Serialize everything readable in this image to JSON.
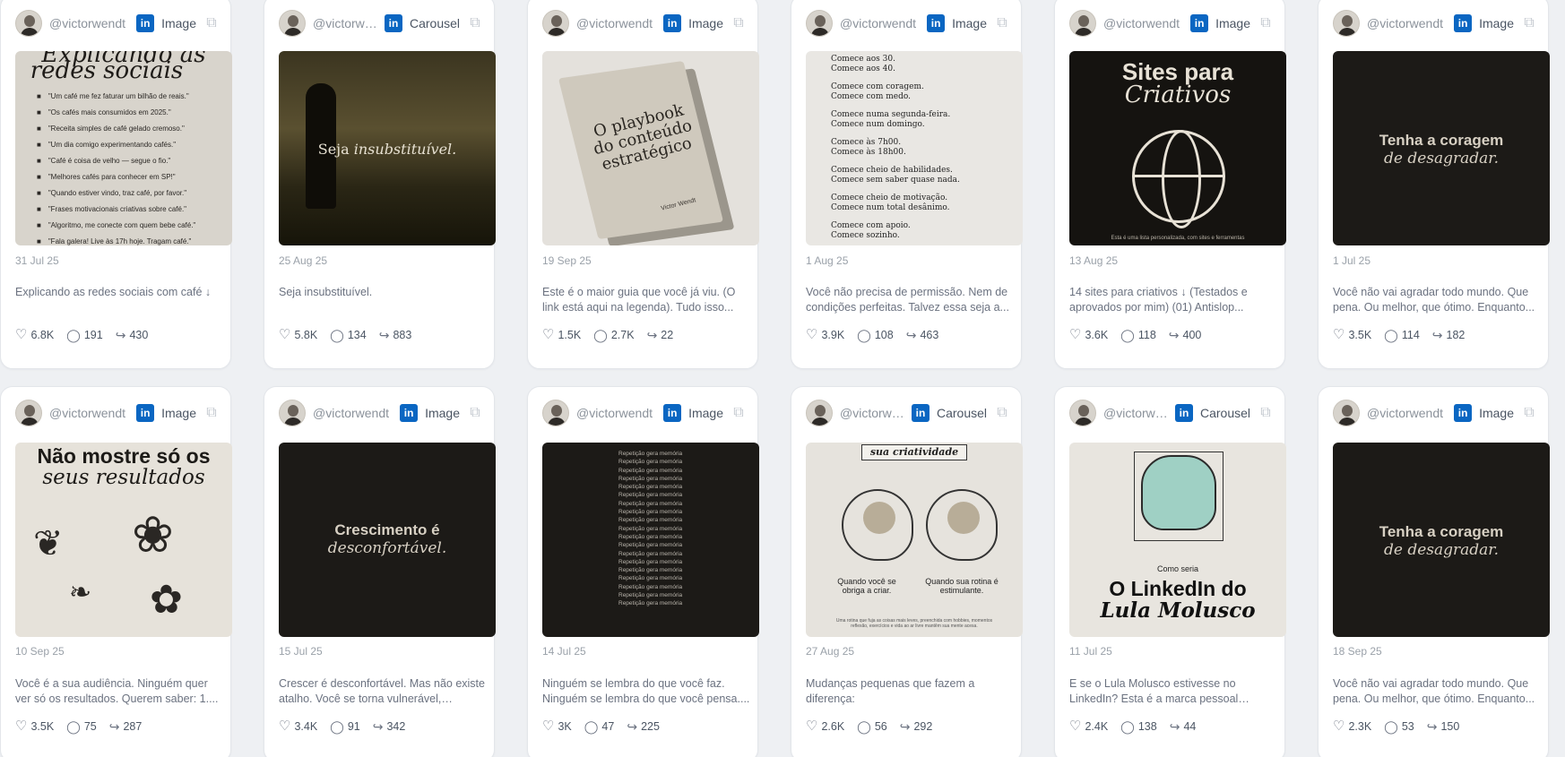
{
  "colors": {
    "background": "#eef0f3",
    "linkedin": "#0a66c2",
    "card": "#ffffff"
  },
  "cards": [
    {
      "handle": "@victorwendt",
      "type": "Image",
      "date": "31 Jul 25",
      "caption": "Explicando as redes sociais com café ↓",
      "likes": "6.8K",
      "comments": "191",
      "shares": "430",
      "media": {
        "title_line1": "Explicando as",
        "title_line2": "redes sociais",
        "lines": [
          "\"Um café me fez faturar um bilhão de reais.\"",
          "\"Os cafés mais consumidos em 2025.\"",
          "\"Receita simples de café gelado cremoso.\"",
          "\"Um dia comigo experimentando cafés.\"",
          "\"Café é coisa de velho — segue o fio.\"",
          "\"Melhores cafés para conhecer em SP!\"",
          "\"Quando estiver vindo, traz café, por favor.\"",
          "\"Frases motivacionais criativas sobre café.\"",
          "\"Algoritmo, me conecte com quem bebe café.\"",
          "\"Fala galera! Live às 17h hoje. Tragam café.\""
        ]
      }
    },
    {
      "handle": "@victorwen...",
      "type": "Carousel",
      "date": "25 Aug 25",
      "caption": "Seja insubstituível.",
      "likes": "5.8K",
      "comments": "134",
      "shares": "883",
      "media": {
        "text_a": "Seja ",
        "text_b": "insubstituível."
      }
    },
    {
      "handle": "@victorwendt",
      "type": "Image",
      "date": "19 Sep 25",
      "caption": "Este é o maior guia que você já viu. (O link está aqui na legenda). Tudo isso...",
      "likes": "1.5K",
      "comments": "2.7K",
      "shares": "22",
      "media": {
        "title": "O playbook do conteúdo estratégico",
        "author": "Victor Wendt"
      }
    },
    {
      "handle": "@victorwendt",
      "type": "Image",
      "date": "1 Aug 25",
      "caption": "Você não precisa de permissão. Nem de condições perfeitas. Talvez essa seja a...",
      "likes": "3.9K",
      "comments": "108",
      "shares": "463",
      "media": {
        "groups": [
          [
            "Comece aos 30.",
            "Comece aos 40."
          ],
          [
            "Comece com coragem.",
            "Comece com medo."
          ],
          [
            "Comece numa segunda-feira.",
            "Comece num domingo."
          ],
          [
            "Comece às 7h00.",
            "Comece às 18h00."
          ],
          [
            "Comece cheio de habilidades.",
            "Comece sem saber quase nada."
          ],
          [
            "Comece cheio de motivação.",
            "Comece num total desânimo."
          ],
          [
            "Comece com apoio.",
            "Comece sozinho."
          ]
        ]
      }
    },
    {
      "handle": "@victorwendt",
      "type": "Image",
      "date": "13 Aug 25",
      "caption": "14 sites para criativos ↓ (Testados e aprovados por mim) (01) Antislop...",
      "likes": "3.6K",
      "comments": "118",
      "shares": "400",
      "media": {
        "title_line1": "Sites para",
        "title_line2": "Criativos",
        "footer": "Esta é uma lista personalizada, com sites e ferramentas"
      }
    },
    {
      "handle": "@victorwendt",
      "type": "Image",
      "date": "1 Jul 25",
      "caption": "Você não vai agradar todo mundo. Que pena. Ou melhor, que ótimo. Enquanto...",
      "likes": "3.5K",
      "comments": "114",
      "shares": "182",
      "media": {
        "line1": "Tenha a coragem",
        "line2": "de desagradar."
      }
    },
    {
      "handle": "@victorwendt",
      "type": "Image",
      "date": "10 Sep 25",
      "caption": "Você é a sua audiência. Ninguém quer ver só os resultados. Querem saber: 1....",
      "likes": "3.5K",
      "comments": "75",
      "shares": "287",
      "media": {
        "line1": "Não mostre só os",
        "line2": "seus resultados"
      }
    },
    {
      "handle": "@victorwendt",
      "type": "Image",
      "date": "15 Jul 25",
      "caption": "Crescer é desconfortável. Mas não existe atalho. Você se torna vulnerável, expost...",
      "likes": "3.4K",
      "comments": "91",
      "shares": "342",
      "media": {
        "line1": "Crescimento é",
        "line2": "desconfortável."
      }
    },
    {
      "handle": "@victorwendt",
      "type": "Image",
      "date": "14 Jul 25",
      "caption": "Ninguém se lembra do que você faz. Ninguém se lembra do que você pensa....",
      "likes": "3K",
      "comments": "47",
      "shares": "225",
      "media": {
        "repeat_text": "Repetição gera memória",
        "repeat_count": 19
      }
    },
    {
      "handle": "@victorwen...",
      "type": "Carousel",
      "date": "27 Aug 25",
      "caption": "Mudanças pequenas que fazem a diferença:",
      "likes": "2.6K",
      "comments": "56",
      "shares": "292",
      "media": {
        "header": "sua criatividade",
        "left": "Quando você se obriga a criar.",
        "right": "Quando sua rotina é estimulante.",
        "footer": "Uma rotina que fuja as coisas mais leves, preenchida com hobbies, momentos reflexão, exercícios e vida ao ar livre mantêm sua mente acesa."
      }
    },
    {
      "handle": "@victorwen...",
      "type": "Carousel",
      "date": "11 Jul 25",
      "caption": "E se o Lula Molusco estivesse no LinkedIn? Esta é a marca pessoal completa, com...",
      "likes": "2.4K",
      "comments": "138",
      "shares": "44",
      "media": {
        "sub": "Como seria",
        "line1": "O LinkedIn do",
        "line2": "Lula Molusco"
      }
    },
    {
      "handle": "@victorwendt",
      "type": "Image",
      "date": "18 Sep 25",
      "caption": "Você não vai agradar todo mundo. Que pena. Ou melhor, que ótimo. Enquanto...",
      "likes": "2.3K",
      "comments": "53",
      "shares": "150",
      "media": {
        "line1": "Tenha a coragem",
        "line2": "de desagradar."
      }
    }
  ]
}
